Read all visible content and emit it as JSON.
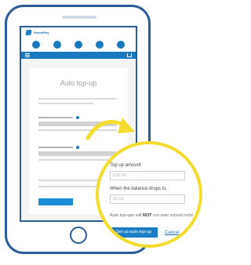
{
  "brand": {
    "name": "ParentPay"
  },
  "page": {
    "title": "Auto top-up"
  },
  "form": {
    "amount_label": "Top up amount",
    "amount_placeholder": "£30.00",
    "threshold_label": "When the balance drops to",
    "threshold_placeholder": "£0.00",
    "note_prefix": "Auto top-ups will ",
    "note_emphasis": "NOT",
    "note_suffix": " run over school holid",
    "setup_button": "Set up auto top-up",
    "cancel_link": "Cancel"
  },
  "icons": {
    "brand": "brand-logo-icon",
    "menu": "hamburger-menu-icon",
    "basket": "basket-icon"
  },
  "colors": {
    "accent_blue": "#1879be",
    "phone_outline": "#2a5d99",
    "highlight_yellow": "#f4dc2f"
  }
}
